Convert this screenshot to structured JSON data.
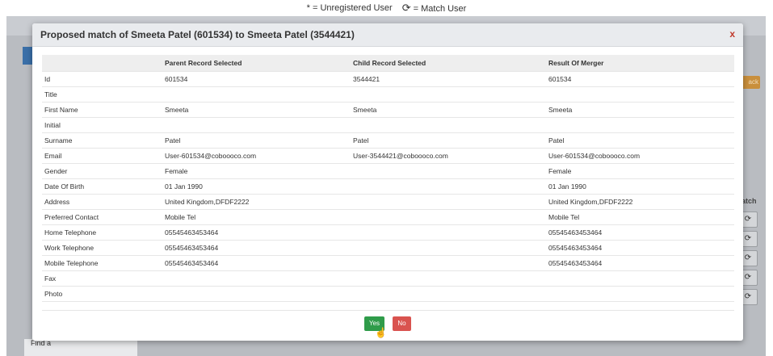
{
  "legend": {
    "unregistered": "* = Unregistered User",
    "match": "= Match User",
    "match_icon": "sync-icon"
  },
  "background": {
    "orange_button_label": "ack",
    "match_column_label": "atch",
    "find_label": "Find a"
  },
  "modal": {
    "title": "Proposed match of Smeeta Patel (601534) to Smeeta Patel (3544421)",
    "close_label": "x",
    "columns": [
      "",
      "Parent Record Selected",
      "Child Record Selected",
      "Result Of Merger"
    ],
    "rows": [
      {
        "field": "Id",
        "parent": "601534",
        "child": "3544421",
        "result": "601534"
      },
      {
        "field": "Title",
        "parent": "",
        "child": "",
        "result": ""
      },
      {
        "field": "First Name",
        "parent": "Smeeta",
        "child": "Smeeta",
        "result": "Smeeta"
      },
      {
        "field": "Initial",
        "parent": "",
        "child": "",
        "result": ""
      },
      {
        "field": "Surname",
        "parent": "Patel",
        "child": "Patel",
        "result": "Patel"
      },
      {
        "field": "Email",
        "parent": "User-601534@coboooco.com",
        "child": "User-3544421@coboooco.com",
        "result": "User-601534@coboooco.com"
      },
      {
        "field": "Gender",
        "parent": "Female",
        "child": "",
        "result": "Female"
      },
      {
        "field": "Date Of Birth",
        "parent": "01 Jan 1990",
        "child": "",
        "result": "01 Jan 1990"
      },
      {
        "field": "Address",
        "parent": "United Kingdom,DFDF2222",
        "child": "",
        "result": "United Kingdom,DFDF2222"
      },
      {
        "field": "Preferred Contact",
        "parent": "Mobile Tel",
        "child": "",
        "result": "Mobile Tel"
      },
      {
        "field": "Home Telephone",
        "parent": "05545463453464",
        "child": "",
        "result": "05545463453464"
      },
      {
        "field": "Work Telephone",
        "parent": "05545463453464",
        "child": "",
        "result": "05545463453464"
      },
      {
        "field": "Mobile Telephone",
        "parent": "05545463453464",
        "child": "",
        "result": "05545463453464"
      },
      {
        "field": "Fax",
        "parent": "",
        "child": "",
        "result": ""
      },
      {
        "field": "Photo",
        "parent": "",
        "child": "",
        "result": ""
      }
    ],
    "yes_label": "Yes",
    "no_label": "No"
  },
  "colors": {
    "yes_button": "#2f9c4a",
    "no_button": "#d9534f",
    "close_x": "#c0392b"
  }
}
